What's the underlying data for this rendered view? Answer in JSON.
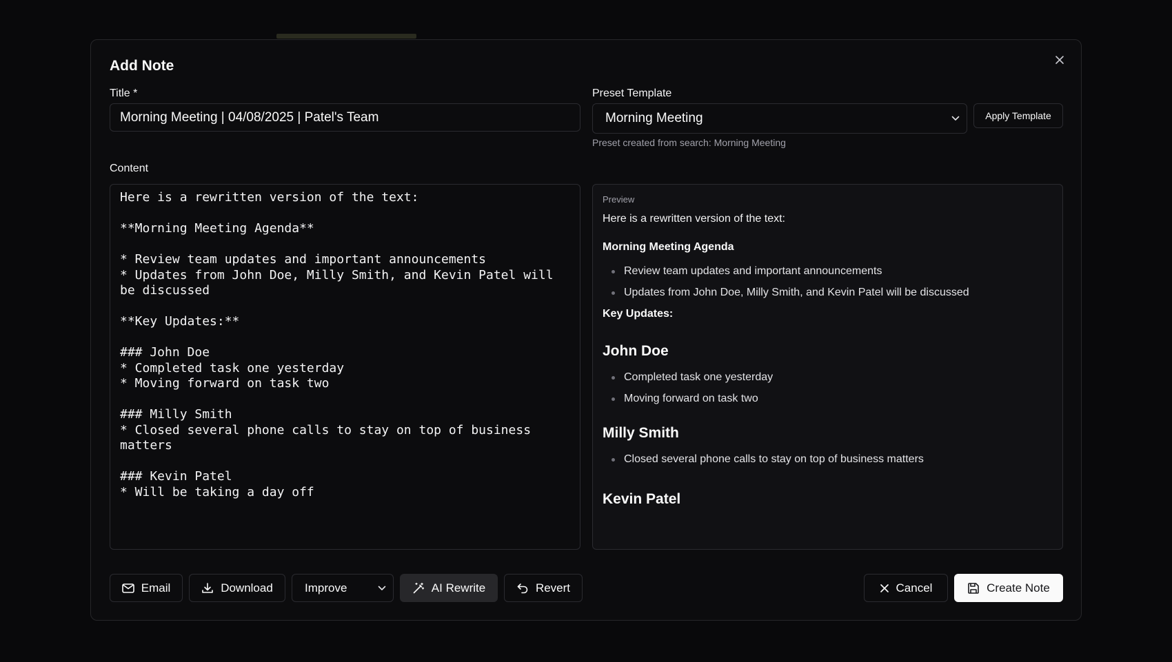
{
  "dialog": {
    "title": "Add Note",
    "close_icon": "close-icon"
  },
  "form": {
    "title_label": "Title *",
    "title_value": "Morning Meeting | 04/08/2025 | Patel's Team",
    "preset_label": "Preset Template",
    "preset_value": "Morning Meeting",
    "apply_template_label": "Apply Template",
    "preset_helper": "Preset created from search: Morning Meeting",
    "content_label": "Content",
    "content_value": "Here is a rewritten version of the text:\n\n**Morning Meeting Agenda**\n\n* Review team updates and important announcements\n* Updates from John Doe, Milly Smith, and Kevin Patel will be discussed\n\n**Key Updates:**\n\n### John Doe\n* Completed task one yesterday\n* Moving forward on task two\n\n### Milly Smith\n* Closed several phone calls to stay on top of business matters\n\n### Kevin Patel\n* Will be taking a day off"
  },
  "preview": {
    "label": "Preview",
    "intro": "Here is a rewritten version of the text:",
    "agenda_heading": "Morning Meeting Agenda",
    "agenda_items": [
      "Review team updates and important announcements",
      "Updates from John Doe, Milly Smith, and Kevin Patel will be discussed"
    ],
    "key_updates_heading": "Key Updates:",
    "people": [
      {
        "name": "John Doe",
        "items": [
          "Completed task one yesterday",
          "Moving forward on task two"
        ]
      },
      {
        "name": "Milly Smith",
        "items": [
          "Closed several phone calls to stay on top of business matters"
        ]
      },
      {
        "name": "Kevin Patel",
        "items": []
      }
    ]
  },
  "footer": {
    "email_label": "Email",
    "download_label": "Download",
    "improve_value": "Improve",
    "ai_rewrite_label": "AI Rewrite",
    "revert_label": "Revert",
    "cancel_label": "Cancel",
    "create_label": "Create Note"
  },
  "icons": [
    "close-icon",
    "chevron-down-icon",
    "mail-icon",
    "download-icon",
    "magic-wand-icon",
    "undo-icon",
    "x-icon",
    "save-icon"
  ],
  "colors": {
    "background": "#09090b",
    "dialog": "#0c0c0e",
    "border": "#2b2b30",
    "primary_button": "#fafafa",
    "secondary_button": "#27272a"
  }
}
